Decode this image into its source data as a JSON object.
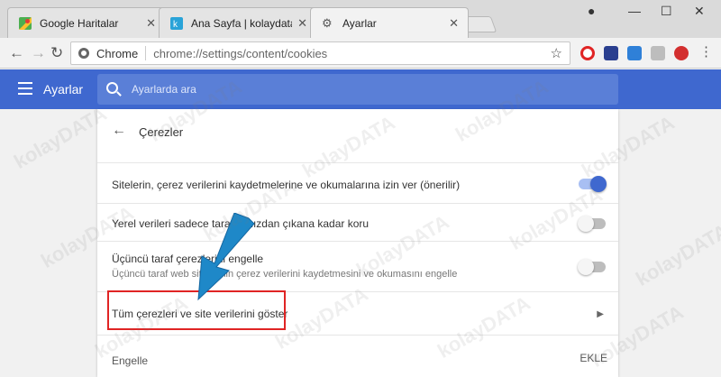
{
  "tabs": [
    {
      "title": "Google Haritalar",
      "icon": "google-maps-icon"
    },
    {
      "title": "Ana Sayfa | kolaydata.cor",
      "icon": "kolaydata-icon"
    },
    {
      "title": "Ayarlar",
      "icon": "gear-icon"
    }
  ],
  "toolbar": {
    "site_label": "Chrome",
    "url": "chrome://settings/content/cookies"
  },
  "header": {
    "title": "Ayarlar",
    "search_placeholder": "Ayarlarda ara"
  },
  "page": {
    "title": "Çerezler",
    "settings": [
      {
        "label": "Sitelerin, çerez verilerini kaydetmelerine ve okumalarına izin ver (önerilir)",
        "enabled": true
      },
      {
        "label": "Yerel verileri sadece tarayıcınızdan çıkana kadar koru",
        "enabled": false
      },
      {
        "label": "Üçüncü taraf çerezlerini engelle",
        "sublabel": "Üçüncü taraf web sitelerinin çerez verilerini kaydetmesini ve okumasını engelle",
        "enabled": false
      }
    ],
    "all_cookies_label": "Tüm çerezleri ve site verilerini göster",
    "block_section_label": "Engelle",
    "add_button_label": "EKLE"
  },
  "colors": {
    "accent": "#3f68cf",
    "highlight": "#e02424",
    "arrow": "#1e88c8"
  },
  "watermark": "kolayDATA"
}
